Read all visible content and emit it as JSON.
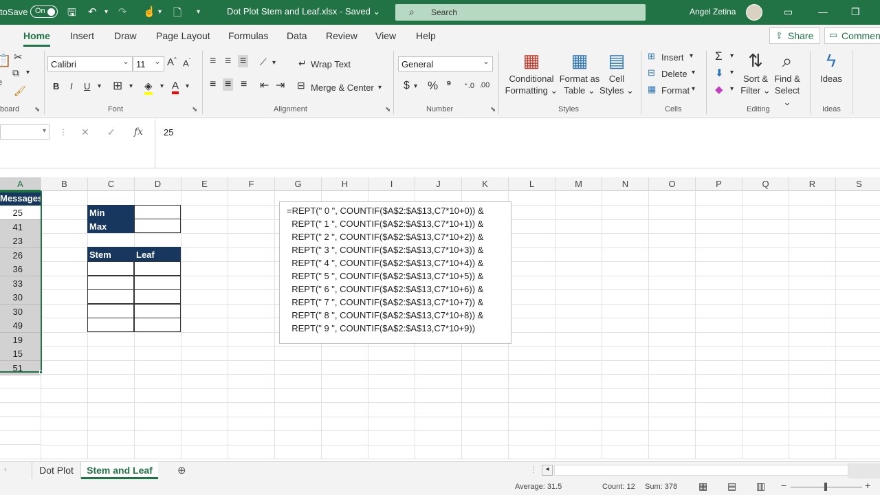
{
  "titlebar": {
    "autosave_label": "toSave",
    "autosave_state": "On",
    "doc_title": "Dot Plot Stem and Leaf.xlsx  -  Saved  ⌄",
    "search_placeholder": "Search",
    "user_name": "Angel Zetina"
  },
  "ribbon_tabs": [
    "Home",
    "Insert",
    "Draw",
    "Page Layout",
    "Formulas",
    "Data",
    "Review",
    "View",
    "Help"
  ],
  "share_label": "Share",
  "comments_label": "Commen",
  "ribbon": {
    "clipboard_label": "board",
    "font_name": "Calibri",
    "font_size": "11",
    "font_label": "Font",
    "wrap_text": "Wrap Text",
    "merge_center": "Merge & Center",
    "alignment_label": "Alignment",
    "number_format": "General",
    "number_label": "Number",
    "conditional_formatting_1": "Conditional",
    "conditional_formatting_2": "Formatting ⌄",
    "format_as_table_1": "Format as",
    "format_as_table_2": "Table ⌄",
    "cell_styles_1": "Cell",
    "cell_styles_2": "Styles ⌄",
    "styles_label": "Styles",
    "insert": "Insert",
    "delete": "Delete",
    "format": "Format",
    "cells_label": "Cells",
    "sort_filter_1": "Sort &",
    "sort_filter_2": "Filter ⌄",
    "find_select_1": "Find &",
    "find_select_2": "Select ⌄",
    "editing_label": "Editing",
    "ideas": "Ideas",
    "ideas_label": "Ideas"
  },
  "formula_bar": {
    "value": "25"
  },
  "columns": [
    "A",
    "B",
    "C",
    "D",
    "E",
    "F",
    "G",
    "H",
    "I",
    "J",
    "K",
    "L",
    "M",
    "N",
    "O",
    "P",
    "Q",
    "R",
    "S"
  ],
  "column_a": {
    "header": "Messages",
    "values": [
      "25",
      "41",
      "23",
      "26",
      "36",
      "33",
      "30",
      "30",
      "49",
      "19",
      "15",
      "51"
    ]
  },
  "minmax": {
    "min_label": "Min",
    "max_label": "Max"
  },
  "stemleaf": {
    "stem_label": "Stem",
    "leaf_label": "Leaf"
  },
  "textbox_lines": [
    "=REPT(\" 0 \", COUNTIF($A$2:$A$13,C7*10+0)) &",
    "  REPT(\" 1 \", COUNTIF($A$2:$A$13,C7*10+1)) &",
    "  REPT(\" 2 \", COUNTIF($A$2:$A$13,C7*10+2)) &",
    "  REPT(\" 3 \", COUNTIF($A$2:$A$13,C7*10+3)) &",
    "  REPT(\" 4 \", COUNTIF($A$2:$A$13,C7*10+4)) &",
    "  REPT(\" 5 \", COUNTIF($A$2:$A$13,C7*10+5)) &",
    "  REPT(\" 6 \", COUNTIF($A$2:$A$13,C7*10+6)) &",
    "  REPT(\" 7 \", COUNTIF($A$2:$A$13,C7*10+7)) &",
    "  REPT(\" 8 \", COUNTIF($A$2:$A$13,C7*10+8)) &",
    "  REPT(\" 9 \", COUNTIF($A$2:$A$13,C7*10+9))"
  ],
  "sheet_tabs": [
    "Dot Plot",
    "Stem and Leaf"
  ],
  "status": {
    "average": "Average: 31.5",
    "count": "Count: 12",
    "sum": "Sum: 378"
  },
  "colors": {
    "accent": "#217346",
    "navy": "#17375e"
  }
}
